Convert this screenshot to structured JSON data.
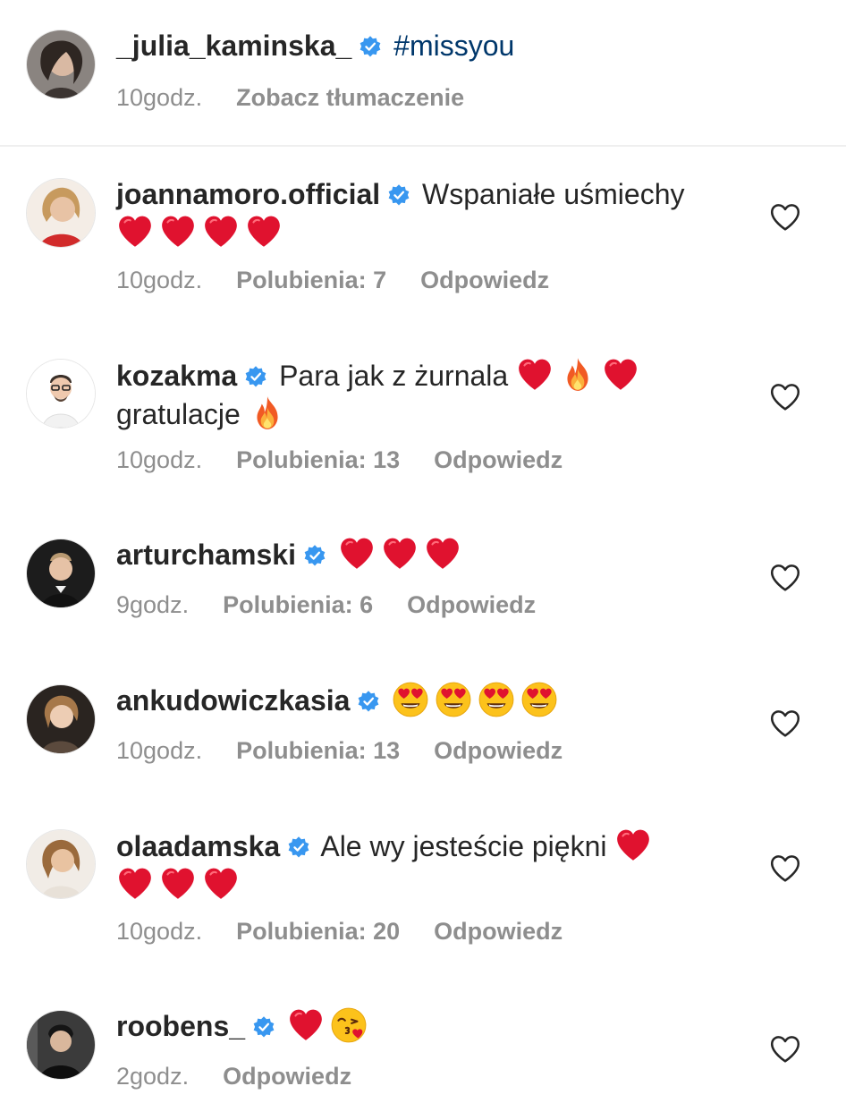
{
  "caption": {
    "username": "_julia_kaminska_",
    "text": "#missyou",
    "time": "10godz.",
    "translate": "Zobacz tłumaczenie"
  },
  "comments": [
    {
      "username": "joannamoro.official",
      "text1": "Wspaniałe uśmiechy",
      "time": "10godz.",
      "likes": "Polubienia: 7",
      "reply": "Odpowiedz"
    },
    {
      "username": "kozakma",
      "text1": "Para jak z żurnala",
      "text2": "gratulacje",
      "time": "10godz.",
      "likes": "Polubienia: 13",
      "reply": "Odpowiedz"
    },
    {
      "username": "arturchamski",
      "time": "9godz.",
      "likes": "Polubienia: 6",
      "reply": "Odpowiedz"
    },
    {
      "username": "ankudowiczkasia",
      "time": "10godz.",
      "likes": "Polubienia: 13",
      "reply": "Odpowiedz"
    },
    {
      "username": "olaadamska",
      "text1": "Ale wy jesteście piękni",
      "time": "10godz.",
      "likes": "Polubienia: 20",
      "reply": "Odpowiedz"
    },
    {
      "username": "roobens_",
      "time": "2godz.",
      "reply": "Odpowiedz"
    }
  ],
  "icons": {
    "verified": "verified-badge-icon",
    "like": "heart-outline-icon",
    "emoji_heart": "red-heart-emoji",
    "emoji_fire": "fire-emoji",
    "emoji_heart_eyes": "heart-eyes-emoji",
    "emoji_kiss": "face-blowing-kiss-emoji"
  },
  "colors": {
    "username": "#262626",
    "meta": "#8e8e8e",
    "hashtag": "#00376b",
    "verified": "#3897f0",
    "heart": "#e0122f"
  }
}
